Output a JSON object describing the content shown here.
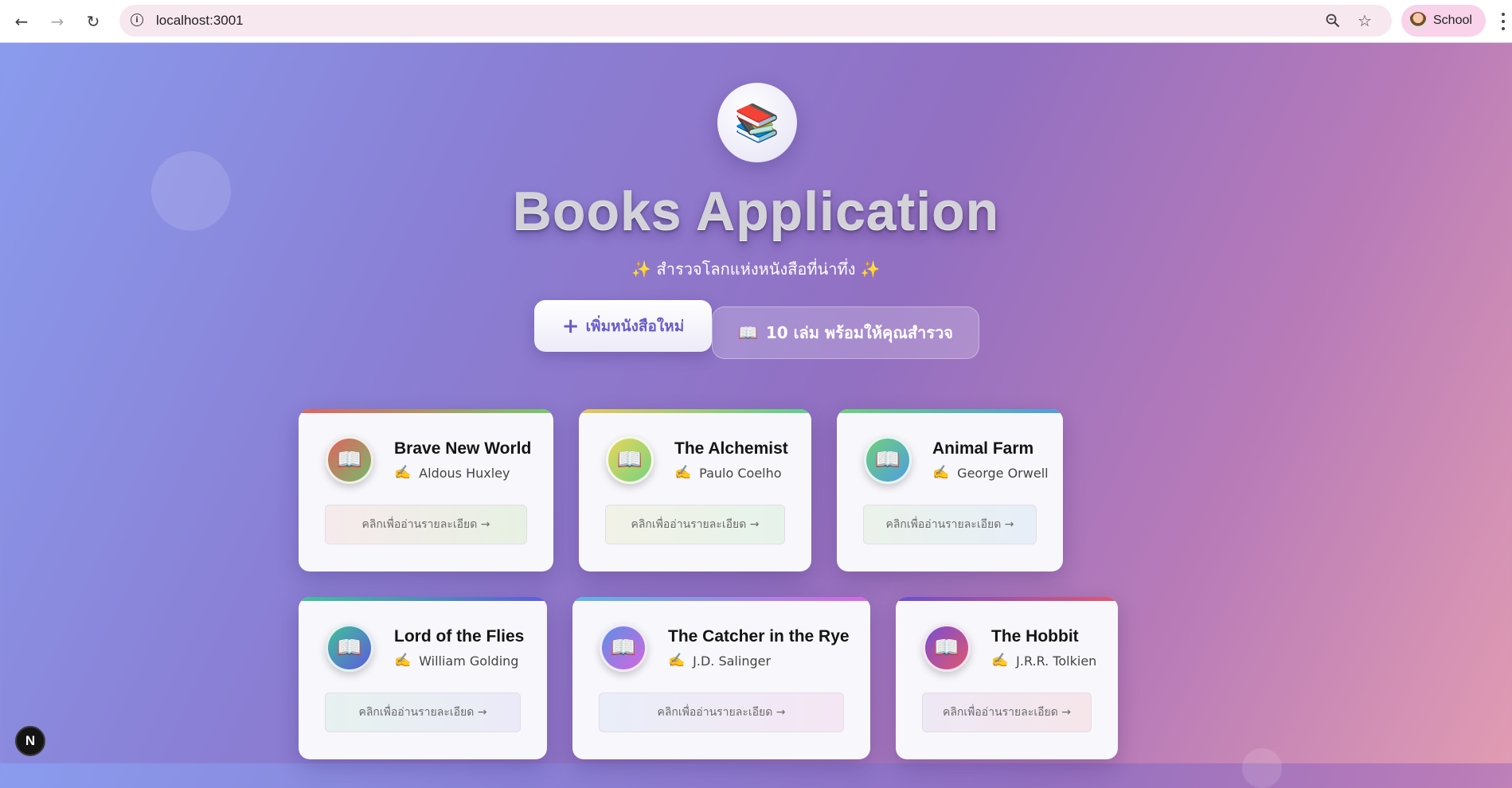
{
  "browser": {
    "url": "localhost:3001",
    "profile_name": "School",
    "icons": {
      "back": "arrow-left-icon",
      "forward": "arrow-right-icon",
      "reload": "reload-icon",
      "info": "info-icon",
      "zoom": "zoom-icon",
      "bookmark": "star-icon",
      "menu": "three-dots-icon"
    }
  },
  "header": {
    "logo_emoji": "📚",
    "title": "Books Application",
    "subtitle": "✨ สำรวจโลกแห่งหนังสือที่น่าทึ่ง ✨",
    "add_button_icon": "+",
    "add_button_label": "เพิ่มหนังสือใหม่",
    "count_icon": "📖",
    "count_label": "10 เล่ม พร้อมให้คุณสำรวจ"
  },
  "books": [
    {
      "title": "Brave New World",
      "author": "Aldous Huxley",
      "icon": "📖",
      "pen": "✍️",
      "cta": "คลิกเพื่ออ่านรายละเอียด →",
      "avatar_gradient": [
        "#e0645e",
        "#78b86b"
      ],
      "bar_gradient": [
        "#e0645e",
        "#78c96b"
      ],
      "btn_gradient": [
        "#f6eaec",
        "#e7f1e3"
      ]
    },
    {
      "title": "The Alchemist",
      "author": "Paulo Coelho",
      "icon": "📖",
      "pen": "✍️",
      "cta": "คลิกเพื่ออ่านรายละเอียด →",
      "avatar_gradient": [
        "#e6d65a",
        "#79d27f"
      ],
      "bar_gradient": [
        "#e6c85a",
        "#5ccf8f"
      ],
      "btn_gradient": [
        "#f2f2e7",
        "#e6f3ea"
      ]
    },
    {
      "title": "Animal Farm",
      "author": "George Orwell",
      "icon": "📖",
      "pen": "✍️",
      "cta": "คลิกเพื่ออ่านรายละเอียด →",
      "avatar_gradient": [
        "#6fd07a",
        "#4d9ee0"
      ],
      "bar_gradient": [
        "#6fd07a",
        "#4d9ee0"
      ],
      "btn_gradient": [
        "#eaf2ea",
        "#e8eef8"
      ]
    },
    {
      "title": "Lord of the Flies",
      "author": "William Golding",
      "icon": "📖",
      "pen": "✍️",
      "cta": "คลิกเพื่ออ่านรายละเอียด →",
      "avatar_gradient": [
        "#3fc29a",
        "#5d5bdc"
      ],
      "bar_gradient": [
        "#3fc29a",
        "#5d5bdc"
      ],
      "btn_gradient": [
        "#e7f1ef",
        "#ebeaf8"
      ]
    },
    {
      "title": "The Catcher in the Rye",
      "author": "J.D. Salinger",
      "icon": "📖",
      "pen": "✍️",
      "cta": "คลิกเพื่ออ่านรายละเอียด →",
      "avatar_gradient": [
        "#5d8fe6",
        "#d467e0"
      ],
      "bar_gradient": [
        "#5db6e6",
        "#d467e0"
      ],
      "btn_gradient": [
        "#e9eef8",
        "#f5e6f4"
      ]
    },
    {
      "title": "The Hobbit",
      "author": "J.R.R. Tolkien",
      "icon": "📖",
      "pen": "✍️",
      "cta": "คลิกเพื่ออ่านรายละเอียด →",
      "avatar_gradient": [
        "#7a4fd1",
        "#e0566f"
      ],
      "bar_gradient": [
        "#6a4fd1",
        "#e0566f"
      ],
      "btn_gradient": [
        "#eee8f5",
        "#f6e6ea"
      ]
    }
  ],
  "dev_indicator": "N"
}
